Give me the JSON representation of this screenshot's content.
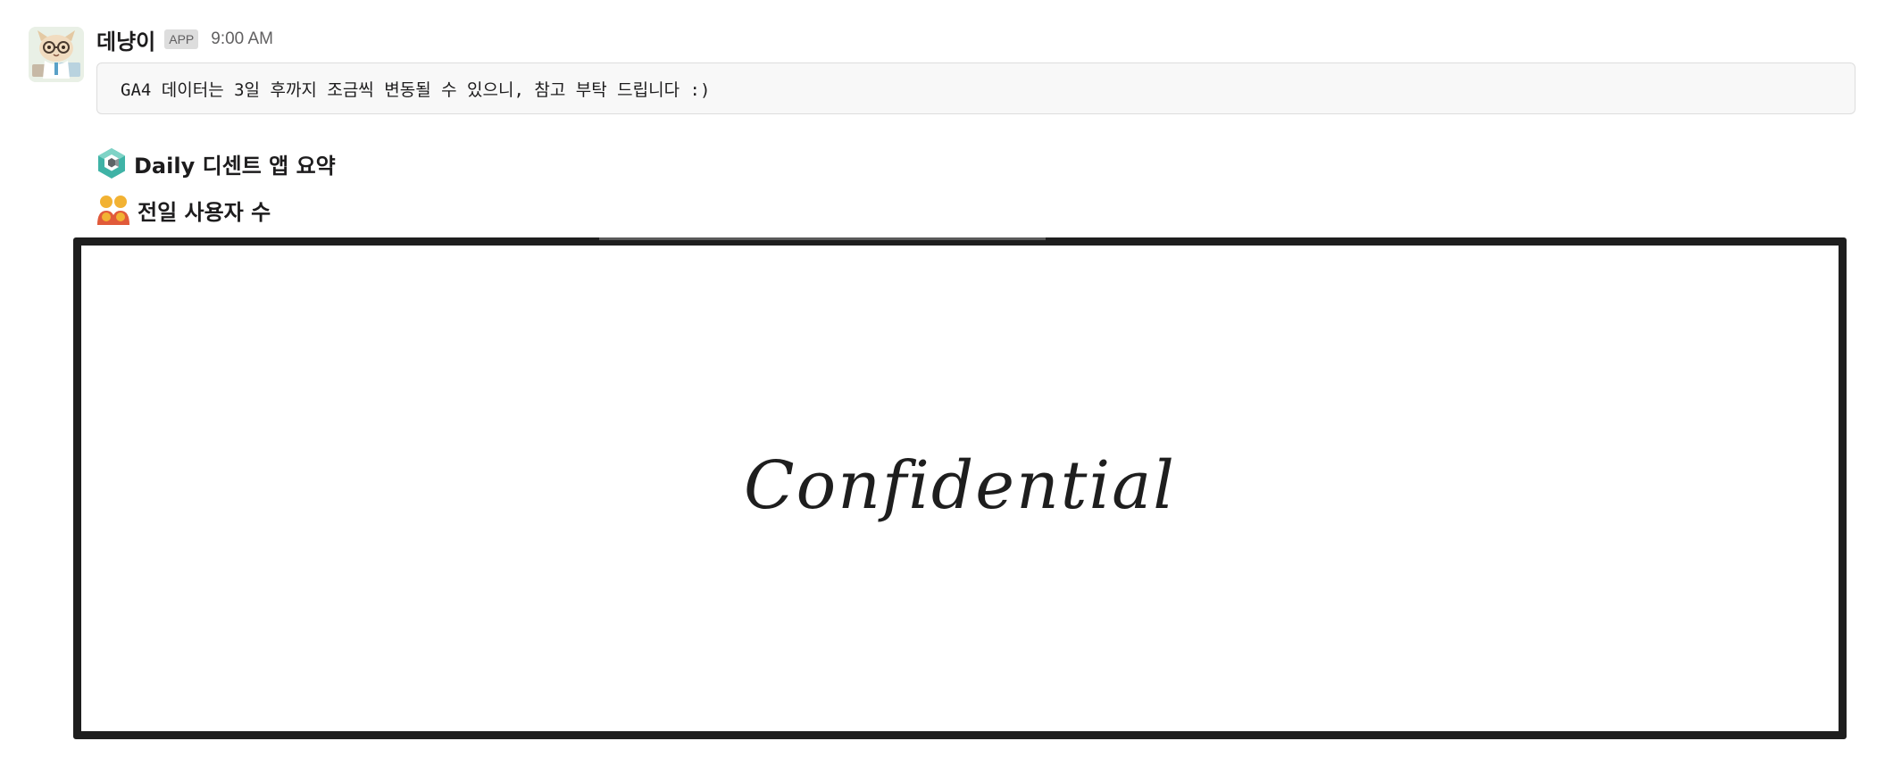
{
  "message": {
    "sender": "데냥이",
    "badge": "APP",
    "timestamp": "9:00 AM",
    "avatar_icon": "cat-avatar-icon",
    "code_text": "GA4 데이터는 3일 후까지 조금씩 변동될 수 있으니, 참고 부탁 드립니다 :)"
  },
  "sections": {
    "summary_title": "Daily 디센트 앱 요약",
    "summary_icon": "hexagon-logo-icon",
    "users_title": "전일 사용자 수",
    "users_icon": "people-icon"
  },
  "attachment": {
    "text": "Confidential"
  },
  "colors": {
    "accent_teal": "#3fb3a6",
    "frame": "#1e1e1e",
    "code_background": "#f8f8f8"
  }
}
